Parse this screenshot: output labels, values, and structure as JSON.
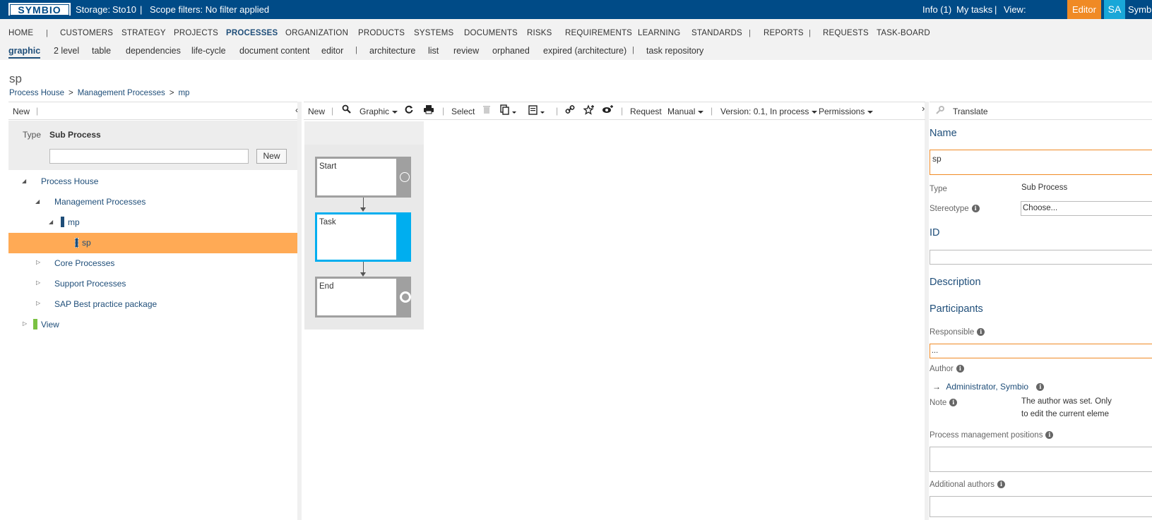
{
  "topbar": {
    "logo": "SYMBIO",
    "storage_label": "Storage:",
    "storage_value": "Sto10",
    "sep": "|",
    "scope_filters": "Scope filters: No filter applied",
    "info": "Info (1)",
    "my_tasks": "My tasks",
    "view_label": "View:",
    "view_mode": "Editor",
    "user_initials": "SA",
    "user_name": "Symbio",
    "colors": {
      "bar": "#004b87",
      "editor": "#f08a24",
      "avatar": "#19a7d8"
    }
  },
  "nav": {
    "items": [
      "HOME",
      "CUSTOMERS",
      "STRATEGY",
      "PROJECTS",
      "PROCESSES",
      "ORGANIZATION",
      "PRODUCTS",
      "SYSTEMS",
      "DOCUMENTS",
      "RISKS",
      "REQUIREMENTS",
      "LEARNING",
      "STANDARDS",
      "REPORTS",
      "REQUESTS",
      "TASK-BOARD"
    ],
    "active": "PROCESSES",
    "sep": "|",
    "sub_items": [
      "graphic",
      "2 level",
      "table",
      "dependencies",
      "life-cycle",
      "document content",
      "editor",
      "architecture",
      "list",
      "review",
      "orphaned",
      "expired (architecture)",
      "task repository"
    ],
    "sub_active": "graphic"
  },
  "page": {
    "title": "sp",
    "breadcrumb": [
      "Process House",
      "Management Processes",
      "mp"
    ],
    "breadcrumb_sep": ">"
  },
  "left": {
    "new_label": "New",
    "sep": "|",
    "collapse_icon": "chevron-left-icon",
    "type_label": "Type",
    "type_value": "Sub Process",
    "search_value": "",
    "search_button": "New",
    "tree": [
      {
        "label": "Process House",
        "level": 0,
        "state": "expanded"
      },
      {
        "label": "Management Processes",
        "level": 1,
        "state": "expanded"
      },
      {
        "label": "mp",
        "level": 2,
        "state": "expanded"
      },
      {
        "label": "sp",
        "level": 3,
        "state": "leaf",
        "selected": true
      },
      {
        "label": "Core Processes",
        "level": 1,
        "state": "collapsed"
      },
      {
        "label": "Support Processes",
        "level": 1,
        "state": "collapsed"
      },
      {
        "label": "SAP Best practice package",
        "level": 1,
        "state": "collapsed"
      },
      {
        "label": "View",
        "level": 0,
        "state": "collapsed"
      }
    ],
    "selected_color": "#ffaa55"
  },
  "center": {
    "toolbar": {
      "new": "New",
      "graphic": "Graphic",
      "select": "Select",
      "request": "Request",
      "manual": "Manual",
      "version": "Version: 0.1, In process",
      "permissions": "Permissions",
      "sep": "|"
    },
    "shapes": [
      {
        "label": "Start",
        "kind": "start"
      },
      {
        "label": "Task",
        "kind": "task"
      },
      {
        "label": "End",
        "kind": "end"
      }
    ],
    "task_color": "#00aeef"
  },
  "right": {
    "translate": "Translate",
    "name_heading": "Name",
    "name_value": "sp",
    "type_label": "Type",
    "type_value": "Sub Process",
    "stereotype_label": "Stereotype",
    "stereotype_value": "Choose...",
    "id_heading": "ID",
    "id_value": "",
    "description_heading": "Description",
    "participants_heading": "Participants",
    "responsible_label": "Responsible",
    "responsible_value": "...",
    "author_label": "Author",
    "author_value": "Administrator, Symbio",
    "note_label": "Note",
    "note_line1": "The author was set. Only",
    "note_line2": "to edit the current eleme",
    "pm_positions_label": "Process management positions",
    "additional_authors_label": "Additional authors"
  }
}
